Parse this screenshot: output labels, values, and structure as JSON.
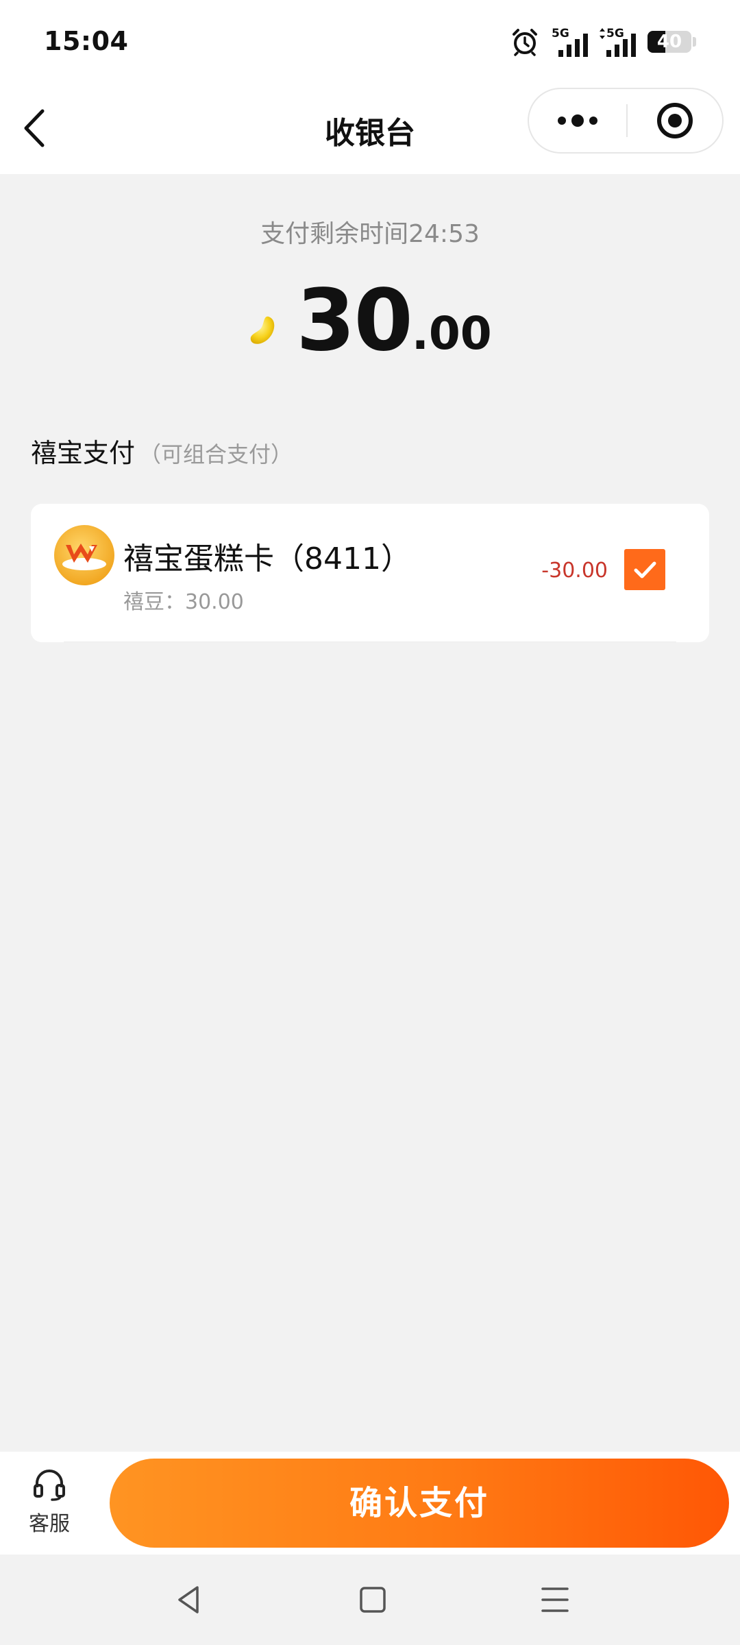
{
  "status_bar": {
    "time": "15:04",
    "signal1_label": "5G",
    "signal2_label": "5G",
    "battery": "40"
  },
  "nav": {
    "title": "收银台"
  },
  "payment": {
    "countdown": "支付剩余时间24:53",
    "amount_integer": "30",
    "amount_decimal": ".00"
  },
  "section": {
    "title": "禧宝支付",
    "subtitle": "（可组合支付）"
  },
  "card": {
    "name": "禧宝蛋糕卡（8411）",
    "balance": "禧豆：30.00",
    "deduction": "-30.00",
    "checked": true
  },
  "bottom": {
    "service_label": "客服",
    "pay_button": "确认支付"
  },
  "colors": {
    "accent": "#ff6a1a",
    "deduction": "#c8362b",
    "background": "#f2f2f2"
  },
  "icons": [
    "alarm-icon",
    "back-arrow-icon",
    "more-icon",
    "close-target-icon",
    "bean-icon",
    "card-logo-icon",
    "check-icon",
    "headset-icon",
    "nav-back-icon",
    "nav-home-icon",
    "nav-menu-icon"
  ]
}
